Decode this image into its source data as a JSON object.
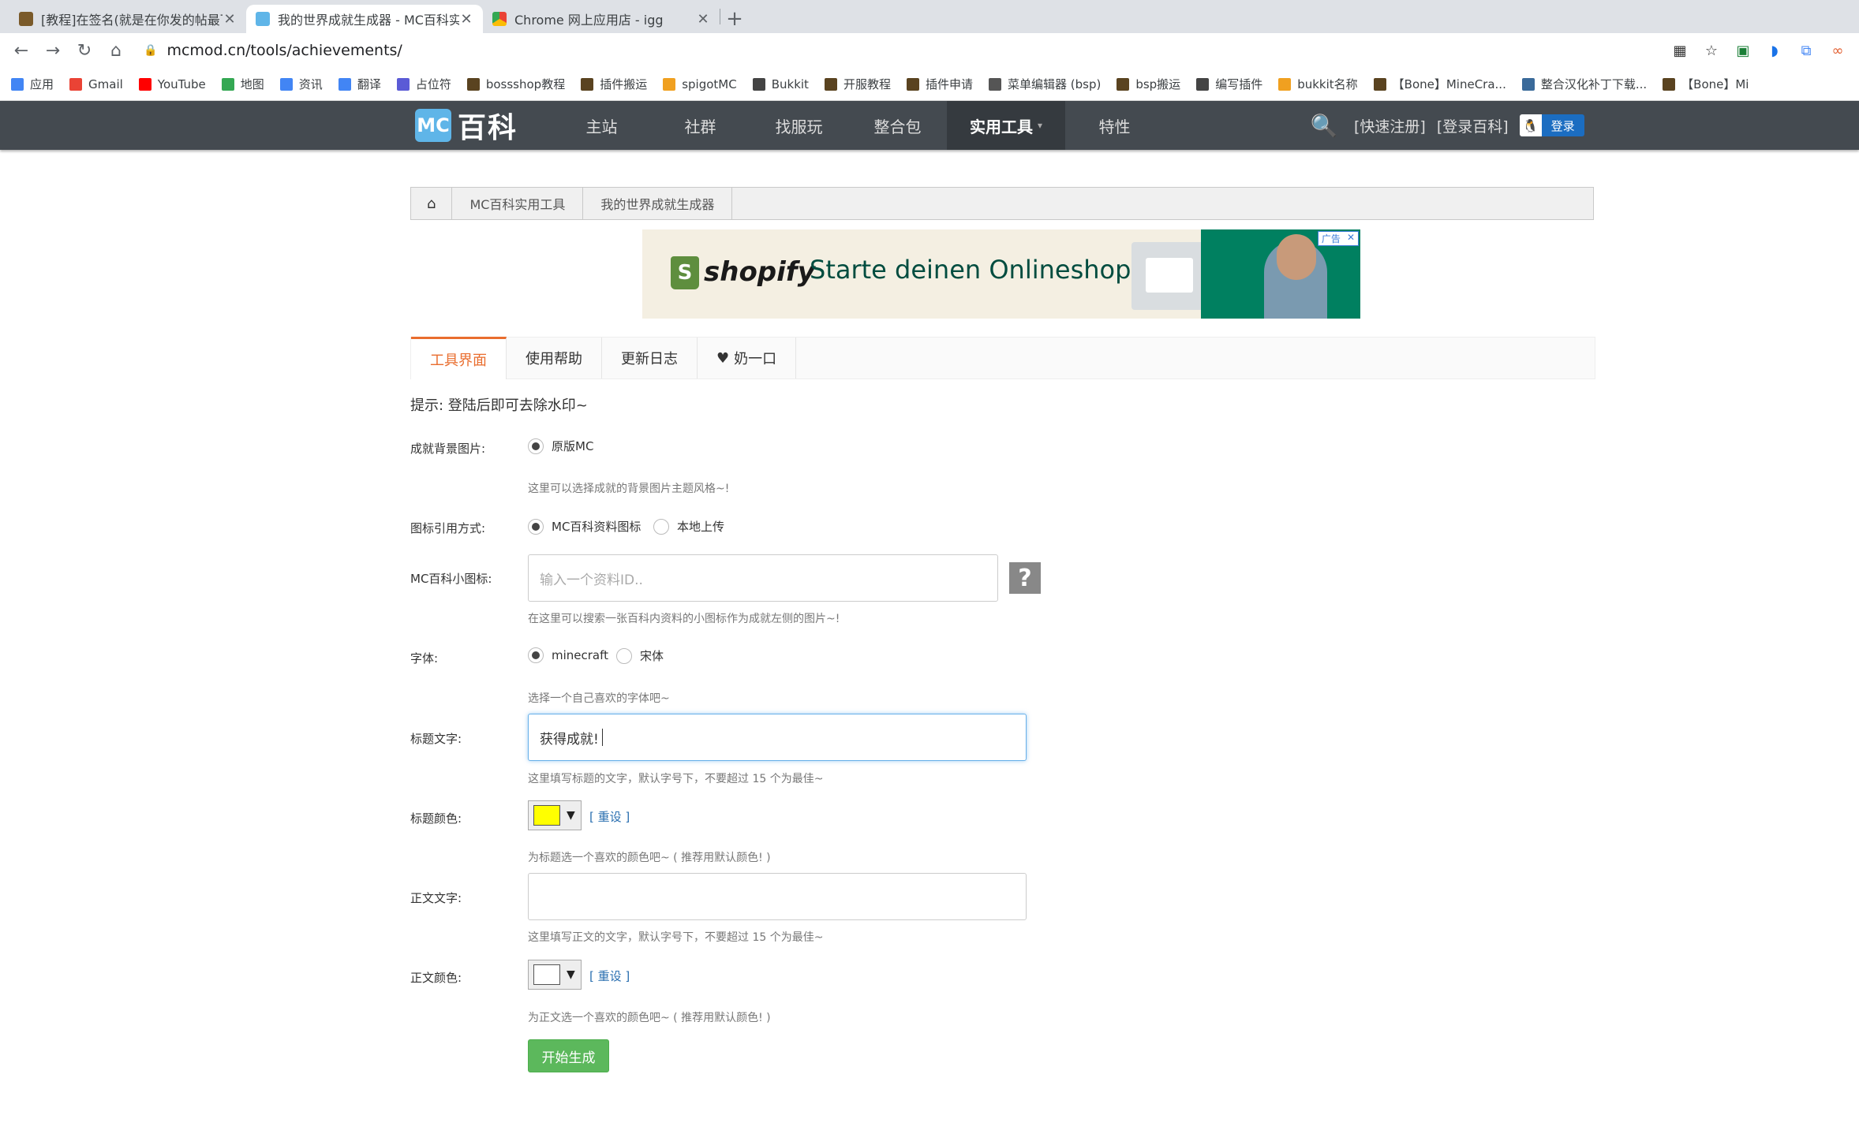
{
  "browser": {
    "tabs": [
      {
        "title": "[教程]在签名(就是在你发的帖最下",
        "active": false,
        "color": "#7a5a2a"
      },
      {
        "title": "我的世界成就生成器 - MC百科实",
        "active": true,
        "color": "#5fb5e8"
      },
      {
        "title": "Chrome 网上应用店 - igg",
        "active": false,
        "color": "#e0463a"
      }
    ],
    "new_tab": "+",
    "url": "mcmod.cn/tools/achievements/"
  },
  "bookmarks": [
    {
      "label": "应用",
      "color": "#4285f4"
    },
    {
      "label": "Gmail",
      "color": "#ea4335"
    },
    {
      "label": "YouTube",
      "color": "#ff0000"
    },
    {
      "label": "地图",
      "color": "#34a853"
    },
    {
      "label": "资讯",
      "color": "#4285f4"
    },
    {
      "label": "翻译",
      "color": "#4285f4"
    },
    {
      "label": "占位符",
      "color": "#5b5bd6"
    },
    {
      "label": "bossshop教程",
      "color": "#5a4320"
    },
    {
      "label": "插件搬运",
      "color": "#5a4320"
    },
    {
      "label": "spigotMC",
      "color": "#f0a020"
    },
    {
      "label": "Bukkit",
      "color": "#444"
    },
    {
      "label": "开服教程",
      "color": "#5a4320"
    },
    {
      "label": "插件申请",
      "color": "#5a4320"
    },
    {
      "label": "菜单编辑器 (bsp)",
      "color": "#555"
    },
    {
      "label": "bsp搬运",
      "color": "#5a4320"
    },
    {
      "label": "编写插件",
      "color": "#444"
    },
    {
      "label": "bukkit名称",
      "color": "#f0a020"
    },
    {
      "label": "【Bone】MineCra...",
      "color": "#5a4320"
    },
    {
      "label": "整合汉化补丁下载...",
      "color": "#3a6a9a"
    },
    {
      "label": "【Bone】Mi",
      "color": "#5a4320"
    }
  ],
  "site": {
    "logo_mc": "MC",
    "logo_text": "百科",
    "menu": [
      "主站",
      "社群",
      "找服玩",
      "整合包",
      "实用工具",
      "特性"
    ],
    "active_menu_index": 4,
    "quick_register": "[快速注册]",
    "login_link": "[登录百科]",
    "qq_login": "登录"
  },
  "breadcrumb": [
    "MC百科实用工具",
    "我的世界成就生成器"
  ],
  "ad": {
    "brand": "shopify",
    "slogan": "Starte deinen Onlineshop",
    "label": "广告"
  },
  "tabs": [
    "工具界面",
    "使用帮助",
    "更新日志",
    "奶一口"
  ],
  "tip": "提示: 登陆后即可去除水印~",
  "form": {
    "background": {
      "label": "成就背景图片:",
      "option": "原版MC",
      "hint": "这里可以选择成就的背景图片主题风格~!"
    },
    "icon_source": {
      "label": "图标引用方式:",
      "options": [
        "MC百科资料图标",
        "本地上传"
      ]
    },
    "mc_icon": {
      "label": "MC百科小图标:",
      "placeholder": "输入一个资料ID..",
      "hint": "在这里可以搜索一张百科内资料的小图标作为成就左侧的图片~!",
      "help": "?"
    },
    "font": {
      "label": "字体:",
      "options": [
        "minecraft",
        "宋体"
      ],
      "hint": "选择一个自己喜欢的字体吧~"
    },
    "title_text": {
      "label": "标题文字:",
      "value": "获得成就!",
      "hint": "这里填写标题的文字，默认字号下，不要超过 15 个为最佳~"
    },
    "title_color": {
      "label": "标题颜色:",
      "color": "#ffff00",
      "reset": "[ 重设 ]",
      "hint": "为标题选一个喜欢的颜色吧~ ( 推荐用默认颜色! )"
    },
    "body_text": {
      "label": "正文文字:",
      "value": "",
      "hint": "这里填写正文的文字，默认字号下，不要超过 15 个为最佳~"
    },
    "body_color": {
      "label": "正文颜色:",
      "color": "#ffffff",
      "reset": "[ 重设 ]",
      "hint": "为正文选一个喜欢的颜色吧~ ( 推荐用默认颜色! )"
    },
    "submit": "开始生成"
  }
}
